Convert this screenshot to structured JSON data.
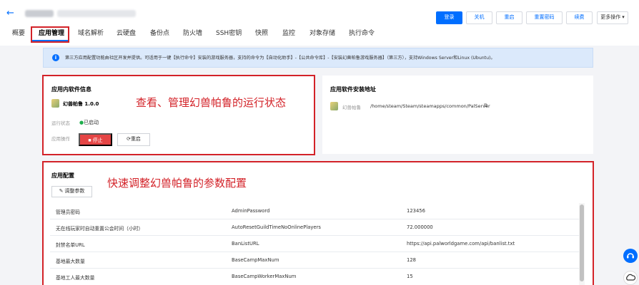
{
  "header": {
    "back_icon": "arrow-left-icon",
    "actions": [
      "登录",
      "关机",
      "重启",
      "重置密码",
      "续费",
      "更多操作 ▾"
    ]
  },
  "tabs": [
    "概要",
    "应用管理",
    "域名解析",
    "云硬盘",
    "备份点",
    "防火墙",
    "SSH密钥",
    "快照",
    "监控",
    "对象存储",
    "执行命令"
  ],
  "active_tab": "应用管理",
  "notice": {
    "icon": "info-icon",
    "text": "第三方应用配置功能由社区开发并提供。可适用于一键【执行命令】安装的游戏服务器，支持的命令为【自动化助手】-【公共命令库】-【安装幻兽帕鲁游戏服务器】（第三方），支持Windows Server和Linux (Ubuntu)。"
  },
  "app_info": {
    "title": "应用内软件信息",
    "app_name": "幻兽帕鲁 1.0.0",
    "status_label": "运行状态",
    "status_value": "已启动",
    "ops_label": "应用操作",
    "stop_label": "停止",
    "restart_label": "重启",
    "annotation": "查看、管理幻兽帕鲁的运行状态"
  },
  "install": {
    "title": "应用软件安装地址",
    "app_name": "幻兽帕鲁",
    "path": "/home/steam/Steam/steamapps/common/PalServer"
  },
  "config": {
    "title": "应用配置",
    "adjust_label": "调整参数",
    "annotation": "快速调整幻兽帕鲁的参数配置",
    "rows": [
      [
        "管理员密码",
        "AdminPassword",
        "123456"
      ],
      [
        "无在线玩家时自动重置公会时间（小时）",
        "AutoResetGuildTimeNoOnlinePlayers",
        "72.000000"
      ],
      [
        "封禁名单URL",
        "BanListURL",
        "https://api.palworldgame.com/api/banlist.txt"
      ],
      [
        "基地最大数量",
        "BaseCampMaxNum",
        "128"
      ],
      [
        "基地工人最大数量",
        "BaseCampWorkerMaxNum",
        "15"
      ]
    ]
  },
  "colors": {
    "primary": "#006eff",
    "danger": "#e54545",
    "annotation": "#d32228",
    "notice_bg": "#dbe9fb"
  }
}
